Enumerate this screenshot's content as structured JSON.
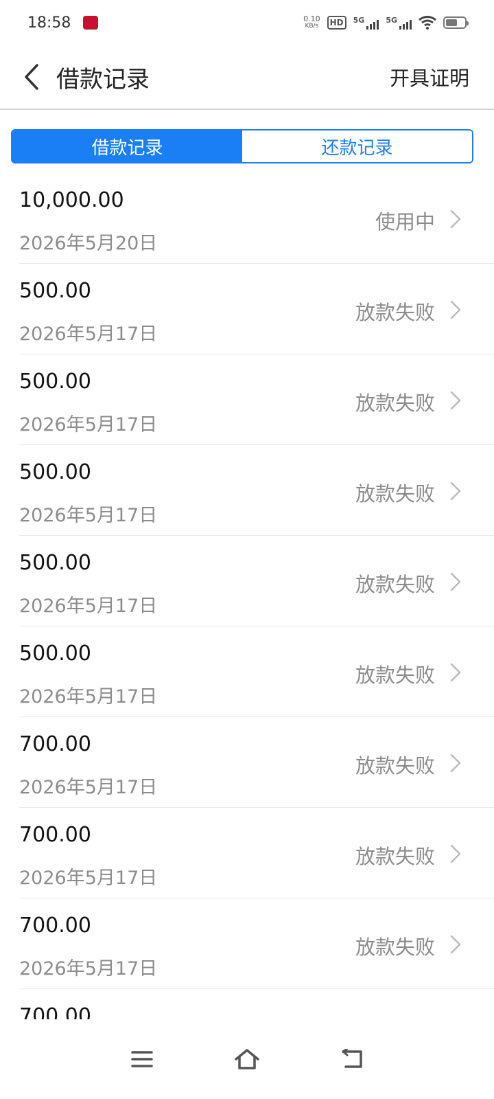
{
  "status_bar": {
    "time": "18:58",
    "net_speed_value": "0.10",
    "net_speed_unit": "KB/s",
    "hd_label": "HD",
    "signal1_label": "5G",
    "signal2_label": "5G"
  },
  "header": {
    "title": "借款记录",
    "action_label": "开具证明"
  },
  "tabs": [
    {
      "label": "借款记录",
      "active": true
    },
    {
      "label": "还款记录",
      "active": false
    }
  ],
  "records": [
    {
      "amount": "10,000.00",
      "date": "2026年5月20日",
      "status": "使用中"
    },
    {
      "amount": "500.00",
      "date": "2026年5月17日",
      "status": "放款失败"
    },
    {
      "amount": "500.00",
      "date": "2026年5月17日",
      "status": "放款失败"
    },
    {
      "amount": "500.00",
      "date": "2026年5月17日",
      "status": "放款失败"
    },
    {
      "amount": "500.00",
      "date": "2026年5月17日",
      "status": "放款失败"
    },
    {
      "amount": "500.00",
      "date": "2026年5月17日",
      "status": "放款失败"
    },
    {
      "amount": "700.00",
      "date": "2026年5月17日",
      "status": "放款失败"
    },
    {
      "amount": "700.00",
      "date": "2026年5月17日",
      "status": "放款失败"
    },
    {
      "amount": "700.00",
      "date": "2026年5月17日",
      "status": "放款失败"
    },
    {
      "amount": "700.00",
      "date": "",
      "status": ""
    }
  ],
  "colors": {
    "accent": "#1a7ff5",
    "secondary_text": "#8c8c8c",
    "divider": "#e8e8e8"
  },
  "icons": {
    "back": "chevron-left-icon",
    "row_arrow": "chevron-right-icon",
    "nav_menu": "menu-icon",
    "nav_home": "home-icon",
    "nav_back": "return-icon"
  }
}
